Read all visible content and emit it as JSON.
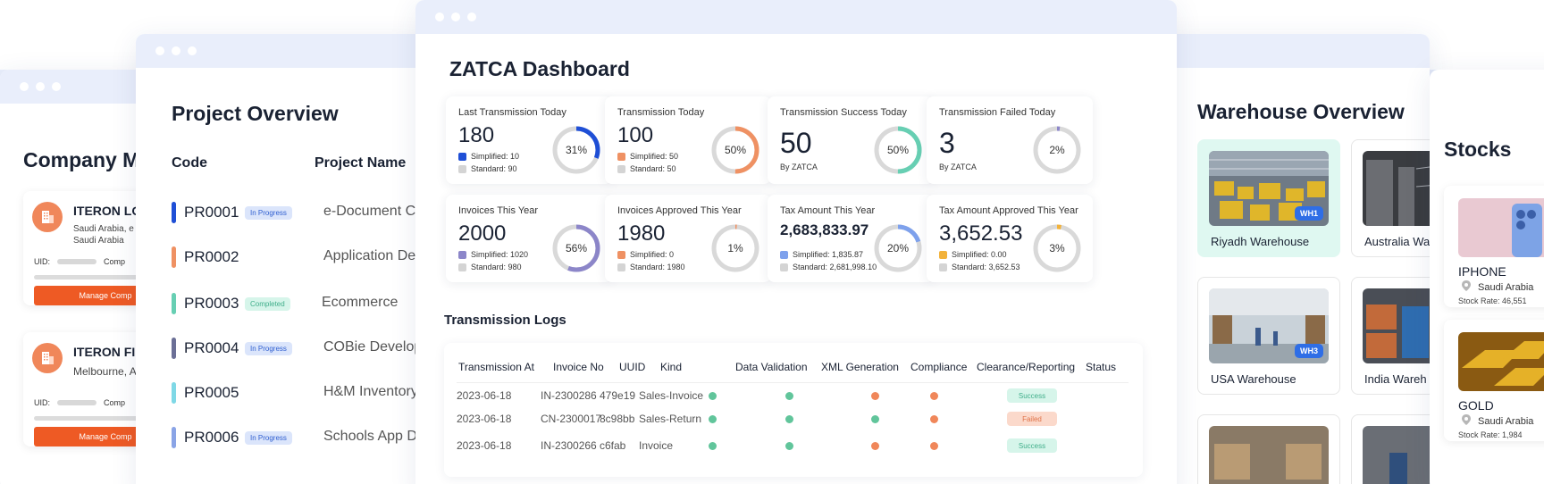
{
  "colors": {
    "accent_orange": "#ee5a24",
    "window_bar": "#e9eefb",
    "simplified_blue": "#1f4fd6",
    "orange_ring": "#ef9163",
    "teal_ring": "#67cfb3",
    "purple_ring": "#8c86c9",
    "success": "#61c59b",
    "error": "#f0875a"
  },
  "company": {
    "title": "Company M",
    "cards": [
      {
        "name": "ITERON LO",
        "address_line1": "Saudi Arabia, e",
        "address_line2": "Saudi Arabia",
        "uid_label": "UID:",
        "comp_label": "Comp",
        "button": "Manage Comp"
      },
      {
        "name": "ITERON FI",
        "address_line1": "Melbourne, A",
        "address_line2": "",
        "uid_label": "UID:",
        "comp_label": "Comp",
        "button": "Manage Comp"
      }
    ]
  },
  "project": {
    "title": "Project Overview",
    "headers": {
      "code": "Code",
      "name": "Project  Name"
    },
    "rows": [
      {
        "code": "PR0001",
        "status": "In Progress",
        "name": "e-Document Cr",
        "bar": "#1f4fd6"
      },
      {
        "code": "PR0002",
        "status": "",
        "name": "Application Dev",
        "bar": "#ef9163"
      },
      {
        "code": "PR0003",
        "status": "Completed",
        "name": "Ecommerce",
        "bar": "#67cfb3"
      },
      {
        "code": "PR0004",
        "status": "In Progress",
        "name": "COBie Develop",
        "bar": "#6b6f96"
      },
      {
        "code": "PR0005",
        "status": "",
        "name": "H&M Inventory",
        "bar": "#7fd8e6"
      },
      {
        "code": "PR0006",
        "status": "In Progress",
        "name": "Schools App D",
        "bar": "#8aa4e6"
      }
    ]
  },
  "zatca": {
    "title": "ZATCA Dashboard",
    "stats": [
      {
        "label": "Last Transmission Today",
        "value": "180",
        "percent": 31,
        "percent_label": "31%",
        "ring_color": "#1f4fd6",
        "sub1_color": "#1f4fd6",
        "sub1": "Simplified: 10",
        "sub2": "Standard: 90"
      },
      {
        "label": "Transmission Today",
        "value": "100",
        "percent": 50,
        "percent_label": "50%",
        "ring_color": "#ef9163",
        "sub1_color": "#ef9163",
        "sub1": "Simplified: 50",
        "sub2": "Standard: 50"
      },
      {
        "label": "Transmission Success Today",
        "value": "50",
        "percent": 50,
        "percent_label": "50%",
        "ring_color": "#67cfb3",
        "note": "By ZATCA"
      },
      {
        "label": "Transmission Failed Today",
        "value": "3",
        "percent": 2,
        "percent_label": "2%",
        "ring_color": "#8c86c9",
        "note": "By ZATCA"
      },
      {
        "label": "Invoices This Year",
        "value": "2000",
        "percent": 56,
        "percent_label": "56%",
        "ring_color": "#8c86c9",
        "sub1_color": "#8c86c9",
        "sub1": "Simplified: 1020",
        "sub2": "Standard: 980"
      },
      {
        "label": "Invoices Approved This Year",
        "value": "1980",
        "percent": 1,
        "percent_label": "1%",
        "ring_color": "#ef9163",
        "sub1_color": "#ef9163",
        "sub1": "Simplified: 0",
        "sub2": "Standard: 1980"
      },
      {
        "label": "Tax Amount This Year",
        "value": "2,683,833.97",
        "percent": 20,
        "percent_label": "20%",
        "ring_color": "#7ea1ec",
        "sub1_color": "#7ea1ec",
        "sub1": "Simplified: 1,835.87",
        "sub2": "Standard: 2,681,998.10"
      },
      {
        "label": "Tax Amount Approved This Year",
        "value": "3,652.53",
        "percent": 3,
        "percent_label": "3%",
        "ring_color": "#f2b23a",
        "sub1_color": "#f2b23a",
        "sub1": "Simplified: 0.00",
        "sub2": "Standard: 3,652.53"
      }
    ],
    "logs": {
      "title": "Transmission Logs",
      "headers": [
        "Transmission At",
        "Invoice No",
        "UUID",
        "Kind",
        "Data Validation",
        "XML Generation",
        "Compliance",
        "Clearance/Reporting",
        "Status"
      ],
      "rows": [
        {
          "at": "2023-06-18",
          "invoice": "IN-2300286",
          "uuid": "479e19",
          "kind": "Sales-Invoice",
          "validation": "#61c59b",
          "xml": "#61c59b",
          "compliance": "#f0875a",
          "clearance": "#f0875a",
          "status": "Success"
        },
        {
          "at": "2023-06-18",
          "invoice": "CN-2300017",
          "uuid": "8c98bb",
          "kind": "Sales-Return",
          "validation": "#61c59b",
          "xml": "#61c59b",
          "compliance": "#61c59b",
          "clearance": "#f0875a",
          "status": "Failed"
        },
        {
          "at": "2023-06-18",
          "invoice": "IN-2300266",
          "uuid": "c6fab",
          "kind": "Invoice",
          "validation": "#61c59b",
          "xml": "#61c59b",
          "compliance": "#f0875a",
          "clearance": "#f0875a",
          "status": "Success"
        }
      ]
    }
  },
  "warehouse": {
    "title": "Warehouse Overview",
    "cards": [
      {
        "name": "Riyadh Warehouse",
        "tag": "WH1"
      },
      {
        "name": "Australia Wa",
        "tag": ""
      },
      {
        "name": "USA Warehouse",
        "tag": "WH3"
      },
      {
        "name": "India Wareh",
        "tag": ""
      }
    ]
  },
  "stocks": {
    "title": "Stocks",
    "items": [
      {
        "name": "IPHONE",
        "location": "Saudi Arabia",
        "rate": "Stock Rate: 46,551"
      },
      {
        "name": "GOLD",
        "location": "Saudi Arabia",
        "rate": "Stock Rate: 1,984"
      }
    ]
  }
}
